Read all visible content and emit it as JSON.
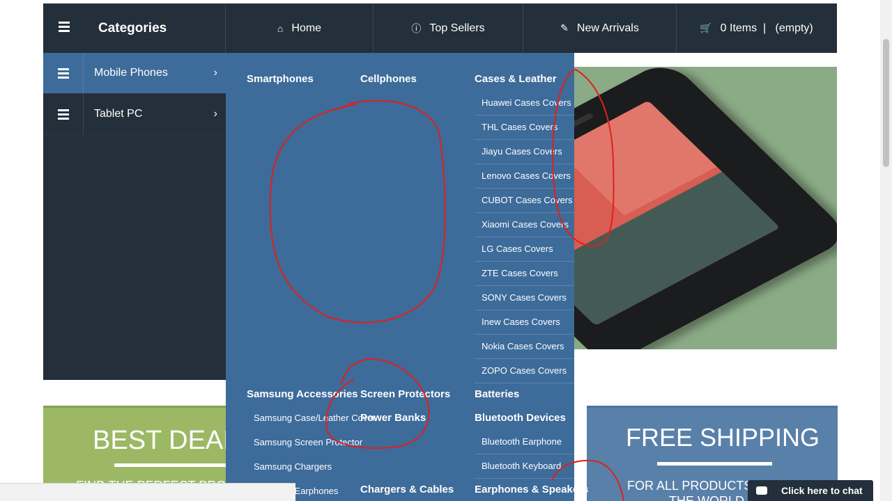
{
  "topnav": {
    "categories_label": "Categories",
    "home": "Home",
    "top_sellers": "Top Sellers",
    "new_arrivals": "New Arrivals",
    "cart": "0 Items  |   (empty)"
  },
  "sidebar": {
    "items": [
      {
        "label": "Mobile Phones"
      },
      {
        "label": "Tablet PC"
      }
    ]
  },
  "mega": {
    "smartphones": "Smartphones",
    "cellphones": "Cellphones",
    "cases_leather": "Cases & Leather",
    "cases_items": [
      "Huawei Cases Covers",
      "THL Cases Covers",
      "Jiayu Cases Covers",
      "Lenovo Cases Covers",
      "CUBOT Cases Covers",
      "Xiaomi Cases Covers",
      "LG Cases Covers",
      "ZTE Cases Covers",
      "SONY Cases Covers",
      "Inew Cases Covers",
      "Nokia Cases Covers",
      "ZOPO Cases Covers"
    ],
    "samsung_accessories": "Samsung Accessories",
    "samsung_items": [
      "Samsung Case/Leather Cover",
      "Samsung Screen Protector",
      "Samsung Chargers",
      "Samsung Earphones"
    ],
    "screen_protectors": "Screen Protectors",
    "power_banks": "Power Banks",
    "chargers_cables": "Chargers & Cables",
    "batteries": "Batteries",
    "bluetooth_devices": "Bluetooth Devices",
    "bluetooth_items": [
      "Bluetooth Earphone",
      "Bluetooth Keyboard"
    ],
    "earphones_speakers": "Earphones & Speakers"
  },
  "banners": {
    "left_title": "BEST DEAL",
    "left_sub": "FIND THE PERFECT PRO",
    "right_title": "FREE SHIPPING",
    "right_sub": "FOR ALL PRODUCTS AND",
    "right_sub2": "THE WORLD"
  },
  "chat": {
    "label": "Click here to chat"
  },
  "colors": {
    "nav_bg": "#232f3a",
    "menu_bg": "#3d6b9a",
    "banner_green": "#9cb865",
    "banner_blue": "#5980a9",
    "annotation_red": "#e0201c"
  }
}
